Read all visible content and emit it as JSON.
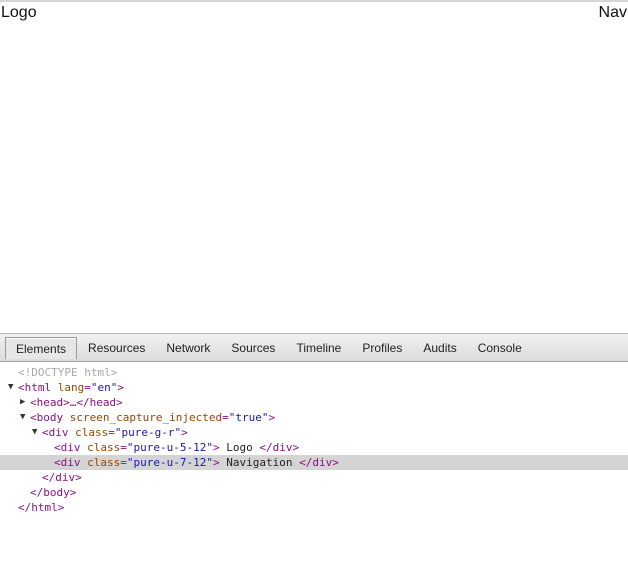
{
  "page": {
    "logo": "Logo",
    "nav": "Nav"
  },
  "devtools": {
    "tabs": [
      "Elements",
      "Resources",
      "Network",
      "Sources",
      "Timeline",
      "Profiles",
      "Audits",
      "Console"
    ],
    "tree": {
      "doctype": "<!DOCTYPE html>",
      "html_open": "<html",
      "html_attr": "lang",
      "html_attr_value": "\"en\"",
      "head": "<head>…</head>",
      "body_open": "<body",
      "body_attr": "screen_capture_injected",
      "body_attr_value": "\"true\"",
      "div_open": "<div",
      "class_attr": "class",
      "grid_class_value": "\"pure-g-r\"",
      "logo_class_value": "\"pure-u-5-12\"",
      "logo_text": " Logo ",
      "nav_class_value": "\"pure-u-7-12\"",
      "nav_text": " Navigation ",
      "div_close": "</div>",
      "body_close": "</body>",
      "html_close": "</html>"
    }
  }
}
